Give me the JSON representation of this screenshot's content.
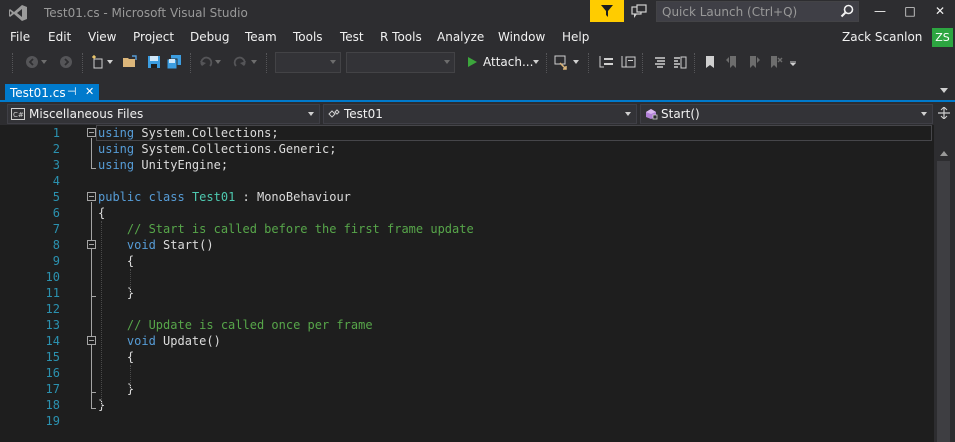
{
  "window": {
    "title": "Test01.cs - Microsoft Visual Studio",
    "quick_launch_placeholder": "Quick Launch (Ctrl+Q)",
    "minimize_glyph": "—",
    "maximize_glyph": "□",
    "close_glyph": "✕"
  },
  "menu": [
    "File",
    "Edit",
    "View",
    "Project",
    "Debug",
    "Team",
    "Tools",
    "Test",
    "R Tools",
    "Analyze",
    "Window",
    "Help"
  ],
  "user": {
    "name": "Zack Scanlon",
    "initials": "ZS"
  },
  "toolbar": {
    "attach_label": "Attach..."
  },
  "tabs": [
    {
      "label": "Test01.cs",
      "pinned_glyph": "⊣",
      "close_glyph": "✕"
    }
  ],
  "navigation": {
    "project": "Miscellaneous Files",
    "type": "Test01",
    "member": "Start()"
  },
  "editor": {
    "line_numbers": [
      "1",
      "2",
      "3",
      "4",
      "5",
      "6",
      "7",
      "8",
      "9",
      "10",
      "11",
      "12",
      "13",
      "14",
      "15",
      "16",
      "17",
      "18",
      "19"
    ],
    "lines": [
      [
        {
          "t": "using",
          "c": "kw"
        },
        {
          "t": " System.Collections;",
          "c": "pl"
        }
      ],
      [
        {
          "t": "using",
          "c": "kw"
        },
        {
          "t": " System.Collections.Generic;",
          "c": "pl"
        }
      ],
      [
        {
          "t": "using",
          "c": "kw"
        },
        {
          "t": " UnityEngine;",
          "c": "pl"
        }
      ],
      [],
      [
        {
          "t": "public",
          "c": "kw"
        },
        {
          "t": " ",
          "c": "pl"
        },
        {
          "t": "class",
          "c": "kw"
        },
        {
          "t": " ",
          "c": "pl"
        },
        {
          "t": "Test01",
          "c": "ty"
        },
        {
          "t": " : MonoBehaviour",
          "c": "pl"
        }
      ],
      [
        {
          "t": "{",
          "c": "pl"
        }
      ],
      [
        {
          "t": "    ",
          "c": "pl"
        },
        {
          "t": "// Start is called before the first frame update",
          "c": "cm"
        }
      ],
      [
        {
          "t": "    ",
          "c": "pl"
        },
        {
          "t": "void",
          "c": "kw"
        },
        {
          "t": " Start()",
          "c": "pl"
        }
      ],
      [
        {
          "t": "    {",
          "c": "pl"
        }
      ],
      [],
      [
        {
          "t": "    }",
          "c": "pl"
        }
      ],
      [],
      [
        {
          "t": "    ",
          "c": "pl"
        },
        {
          "t": "// Update is called once per frame",
          "c": "cm"
        }
      ],
      [
        {
          "t": "    ",
          "c": "pl"
        },
        {
          "t": "void",
          "c": "kw"
        },
        {
          "t": " Update()",
          "c": "pl"
        }
      ],
      [
        {
          "t": "    {",
          "c": "pl"
        }
      ],
      [],
      [
        {
          "t": "    }",
          "c": "pl"
        }
      ],
      [
        {
          "t": "}",
          "c": "pl"
        }
      ],
      []
    ]
  },
  "colors": {
    "accent": "#007acc",
    "keyword": "#569cd6",
    "type": "#4ec9b0",
    "comment": "#57a64a",
    "line_number": "#2b91af",
    "filter_yellow": "#ffcc00",
    "avatar_green": "#2da641"
  }
}
